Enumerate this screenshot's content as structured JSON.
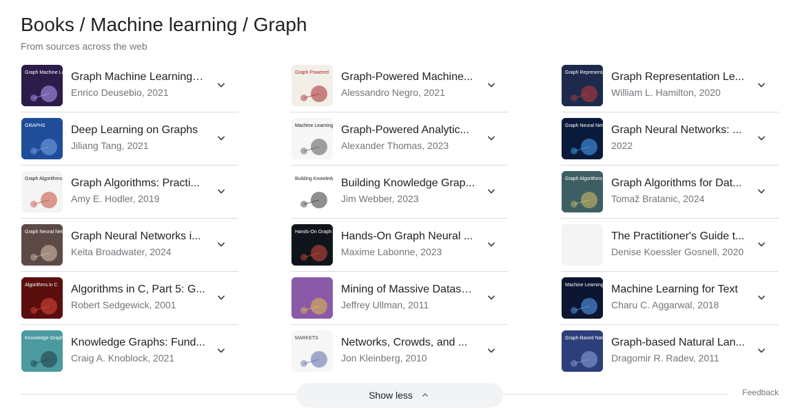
{
  "header": {
    "title": "Books / Machine learning / Graph",
    "subtitle": "From sources across the web"
  },
  "columns": [
    [
      {
        "title": "Graph Machine Learning: ...",
        "meta": "Enrico Deusebio, 2021",
        "cover": {
          "bg": "#2b1c4a",
          "accent": "#b9a3ff",
          "label": "Graph Machine Learning",
          "text_color": "#ffffff"
        }
      },
      {
        "title": "Deep Learning on Graphs",
        "meta": "Jiliang Tang, 2021",
        "cover": {
          "bg": "#1f4d9a",
          "accent": "#7fa8e6",
          "label": "GRAPHS",
          "text_color": "#ffffff"
        }
      },
      {
        "title": "Graph Algorithms: Practi...",
        "meta": "Amy E. Hodler, 2019",
        "cover": {
          "bg": "#f4f4f4",
          "accent": "#c44a3a",
          "label": "Graph Algorithms",
          "text_color": "#222222"
        }
      },
      {
        "title": "Graph Neural Networks i...",
        "meta": "Keita Broadwater, 2024",
        "cover": {
          "bg": "#5d4a47",
          "accent": "#d8c7b0",
          "label": "Graph Neural Networks",
          "text_color": "#ffffff"
        }
      },
      {
        "title": "Algorithms in C, Part 5: G...",
        "meta": "Robert Sedgewick, 2001",
        "cover": {
          "bg": "#5b0e0e",
          "accent": "#e04b3b",
          "label": "Algorithms in C",
          "text_color": "#ffffff"
        }
      },
      {
        "title": "Knowledge Graphs: Fund...",
        "meta": "Craig A. Knoblock, 2021",
        "cover": {
          "bg": "#4a9aa0",
          "accent": "#1e3b40",
          "label": "Knowledge Graphs",
          "text_color": "#ffffff"
        }
      }
    ],
    [
      {
        "title": "Graph-Powered Machine...",
        "meta": "Alessandro Negro, 2021",
        "cover": {
          "bg": "#f2efe9",
          "accent": "#a4282a",
          "label": "Graph Powered",
          "text_color": "#a4282a"
        }
      },
      {
        "title": "Graph-Powered Analytic...",
        "meta": "Alexander Thomas, 2023",
        "cover": {
          "bg": "#f6f6f6",
          "accent": "#555555",
          "label": "Machine Learning with TigerGraph",
          "text_color": "#222222"
        }
      },
      {
        "title": "Building Knowledge Grap...",
        "meta": "Jim Webber, 2023",
        "cover": {
          "bg": "#ffffff",
          "accent": "#333333",
          "label": "Building Knowledge Graphs",
          "text_color": "#222222"
        }
      },
      {
        "title": "Hands-On Graph Neural ...",
        "meta": "Maxime Labonne, 2023",
        "cover": {
          "bg": "#10151c",
          "accent": "#d64a3c",
          "label": "Hands-On Graph Neural Networks",
          "text_color": "#ffffff"
        }
      },
      {
        "title": "Mining of Massive Datase...",
        "meta": "Jeffrey Ullman, 2011",
        "cover": {
          "bg": "#8a5aa8",
          "accent": "#e2c04a",
          "label": "",
          "text_color": "#ffffff"
        }
      },
      {
        "title": "Networks, Crowds, and ...",
        "meta": "Jon Kleinberg, 2010",
        "cover": {
          "bg": "#f6f6f6",
          "accent": "#5b6aa8",
          "label": "MARKETS",
          "text_color": "#444444"
        }
      }
    ],
    [
      {
        "title": "Graph Representation Le...",
        "meta": "William L. Hamilton, 2020",
        "cover": {
          "bg": "#1d2a4d",
          "accent": "#c23b3b",
          "label": "Graph Representation Learning",
          "text_color": "#ffffff"
        }
      },
      {
        "title": "Graph Neural Networks: ...",
        "meta": "2022",
        "cover": {
          "bg": "#0a1a3a",
          "accent": "#4aa8ff",
          "label": "Graph Neural Networks",
          "text_color": "#ffffff"
        }
      },
      {
        "title": "Graph Algorithms for Dat...",
        "meta": "Tomaž Bratanic, 2024",
        "cover": {
          "bg": "#3d5f63",
          "accent": "#d8c06a",
          "label": "Graph Algorithms",
          "text_color": "#ffffff"
        }
      },
      {
        "title": "The Practitioner's Guide t...",
        "meta": "Denise Koessler Gosnell, 2020",
        "cover": {
          "bg": "#f4f4f4",
          "accent": "#f4f4f4",
          "label": "",
          "text_color": "#222222"
        }
      },
      {
        "title": "Machine Learning for Text",
        "meta": "Charu C. Aggarwal, 2018",
        "cover": {
          "bg": "#0c1630",
          "accent": "#5aa8ff",
          "label": "Machine Learning for Text",
          "text_color": "#ffffff"
        }
      },
      {
        "title": "Graph-based Natural Lan...",
        "meta": "Dragomir R. Radev, 2011",
        "cover": {
          "bg": "#2d3f7a",
          "accent": "#8fa6e0",
          "label": "Graph-Based Natural Language Processing",
          "text_color": "#ffffff"
        }
      }
    ]
  ],
  "footer": {
    "show_less_label": "Show less",
    "feedback_label": "Feedback"
  },
  "icons": {
    "expand": "chevron-down-icon",
    "collapse": "chevron-up-icon"
  }
}
